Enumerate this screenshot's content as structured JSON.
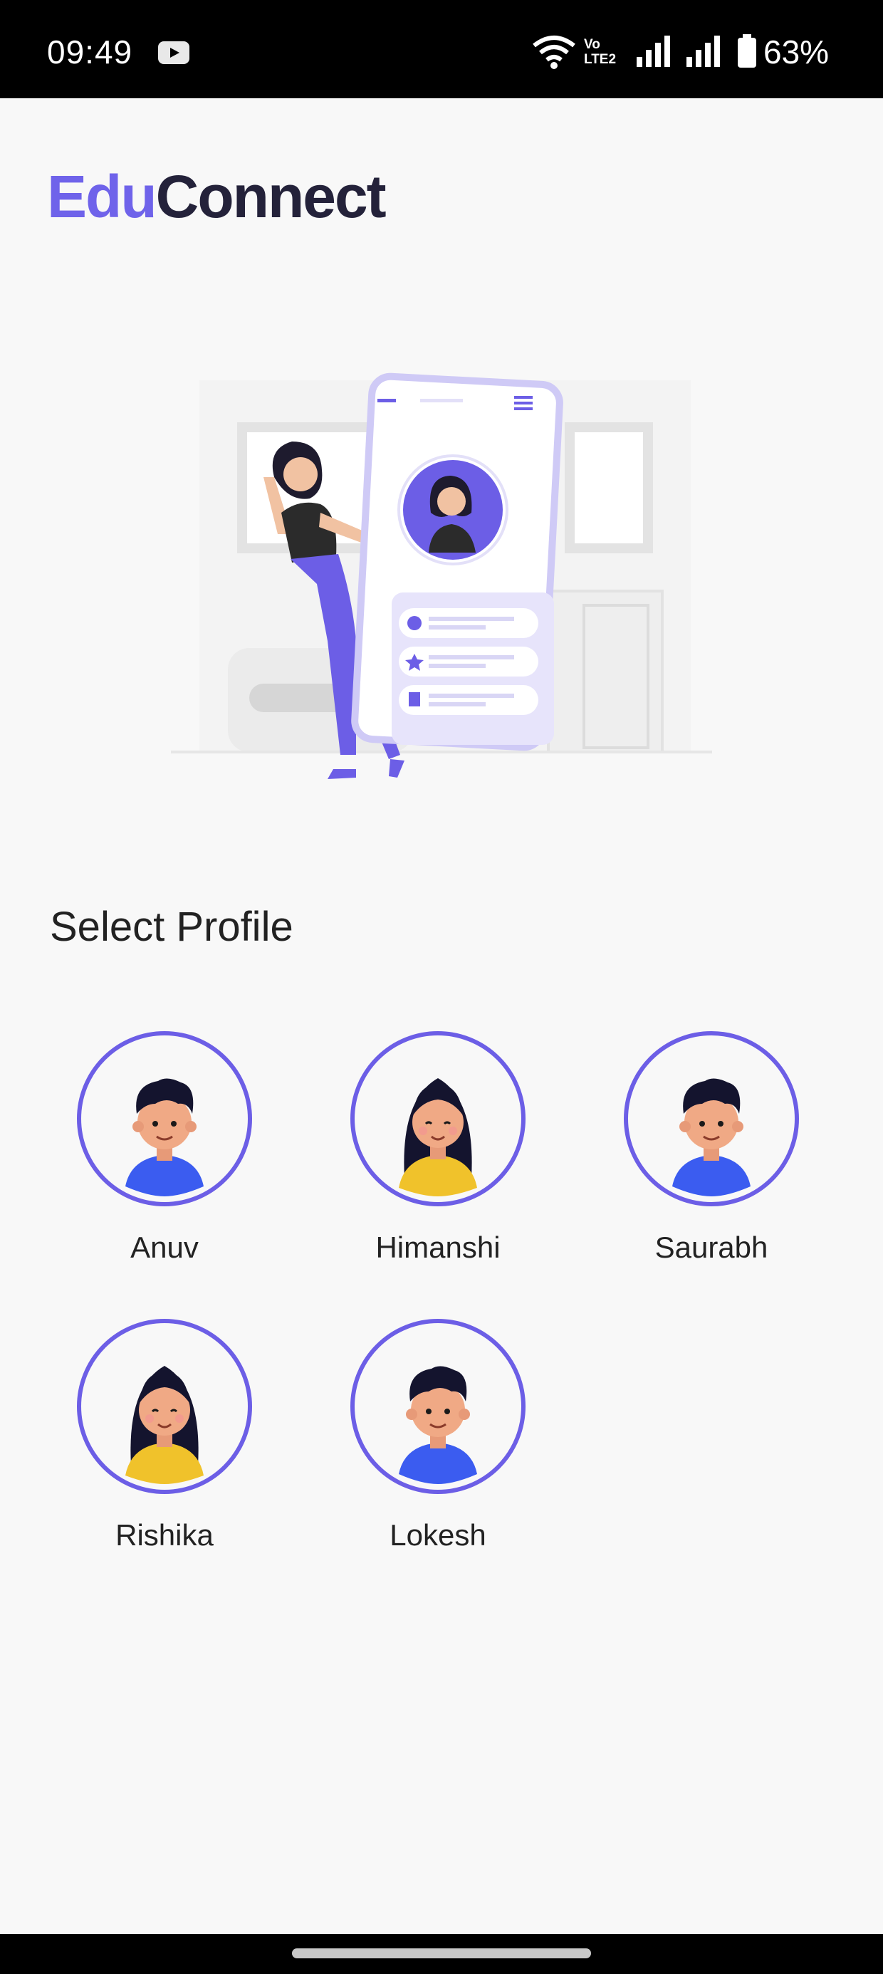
{
  "status_bar": {
    "time": "09:49",
    "network_label": "Vo LTE2",
    "battery": "63%"
  },
  "app": {
    "logo_part1": "Edu",
    "logo_part2": "Connect",
    "brand_color": "#6f63ea"
  },
  "profiles_section": {
    "title": "Select Profile",
    "profiles": [
      {
        "name": "Anuv",
        "avatar": "boy-avatar-icon"
      },
      {
        "name": "Himanshi",
        "avatar": "girl-avatar-icon"
      },
      {
        "name": "Saurabh",
        "avatar": "boy-avatar-icon"
      },
      {
        "name": "Rishika",
        "avatar": "girl-avatar-icon"
      },
      {
        "name": "Lokesh",
        "avatar": "boy-avatar-icon"
      }
    ]
  }
}
